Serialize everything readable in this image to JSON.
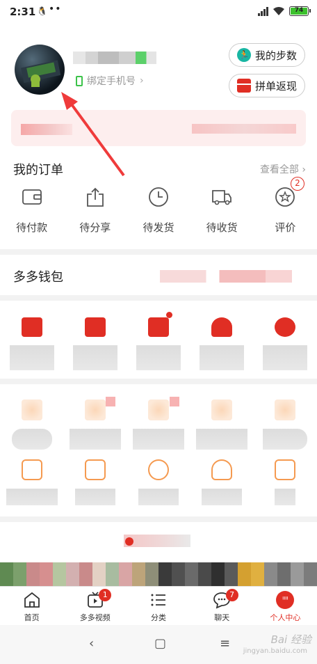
{
  "status_bar": {
    "time": "2:31",
    "battery": "74"
  },
  "profile": {
    "bind_phone": "绑定手机号",
    "steps_button": "我的步数",
    "rebate_button": "拼单返现"
  },
  "orders": {
    "title": "我的订单",
    "see_all": "查看全部",
    "items": [
      {
        "label": "待付款",
        "icon": "wallet-icon"
      },
      {
        "label": "待分享",
        "icon": "share-icon"
      },
      {
        "label": "待发货",
        "icon": "clock-icon"
      },
      {
        "label": "待收货",
        "icon": "truck-icon"
      },
      {
        "label": "评价",
        "icon": "review-icon",
        "badge": "2"
      }
    ]
  },
  "wallet": {
    "title": "多多钱包"
  },
  "tabbar": {
    "items": [
      {
        "label": "首页",
        "icon": "home-icon"
      },
      {
        "label": "多多视频",
        "icon": "video-icon",
        "badge": "1"
      },
      {
        "label": "分类",
        "icon": "category-icon"
      },
      {
        "label": "聊天",
        "icon": "chat-icon",
        "badge": "7"
      },
      {
        "label": "个人中心",
        "icon": "profile-icon",
        "active": true
      }
    ]
  },
  "watermark": {
    "text": "Bai 经验",
    "sub": "jingyan.baidu.com"
  },
  "colors": {
    "accent": "#e02e24",
    "green": "#3cc34a",
    "teal": "#19b6a3"
  }
}
